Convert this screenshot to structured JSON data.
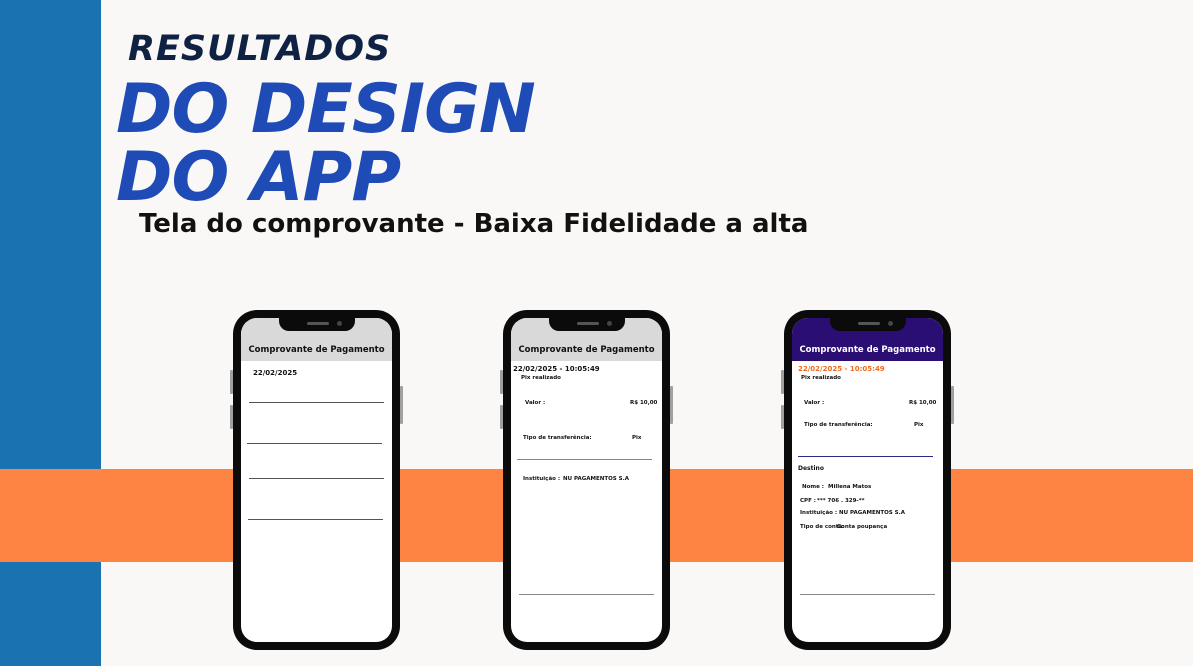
{
  "colors": {
    "background": "#f9f8f6",
    "side_bar": "#1a72b0",
    "stripe": "#fe8444",
    "title_dark": "#0f2244",
    "title_blue": "#1e4bb5",
    "header_gray": "#d9d9d9",
    "header_purple": "#2a0e74",
    "date_orange": "#f26a1b"
  },
  "heading": {
    "line1": "RESULTADOS",
    "line2": "DO DESIGN",
    "line3": "DO APP",
    "subtitle": "Tela do comprovante - Baixa Fidelidade a alta"
  },
  "phone1": {
    "header_title": "Comprovante de Pagamento",
    "date": "22/02/2025"
  },
  "phone2": {
    "header_title": "Comprovante de Pagamento",
    "datetime": "22/02/2025 - 10:05:49",
    "status": "Pix realizado",
    "value_label": "Valor :",
    "value": "R$ 10,00",
    "transfer_label": "Tipo de transferência:",
    "transfer_value": "Pix",
    "institution_label": "Instituição :",
    "institution_value": "NU PAGAMENTOS S.A"
  },
  "phone3": {
    "header_title": "Comprovante de Pagamento",
    "datetime": "22/02/2025 - 10:05:49",
    "status": "Pix realizado",
    "value_label": "Valor :",
    "value": "R$ 10,00",
    "transfer_label": "Tipo de transferência:",
    "transfer_value": "Pix",
    "destination_title": "Destino",
    "name_label": "Nome :",
    "name_value": "Millena Matos",
    "cpf_label": "CPF :",
    "cpf_value": "*** 706 . 329-**",
    "institution_label": "Instituição :",
    "institution_value": "NU PAGAMENTOS S.A",
    "account_label": "Tipo de conta:",
    "account_value": "Conta poupança"
  }
}
